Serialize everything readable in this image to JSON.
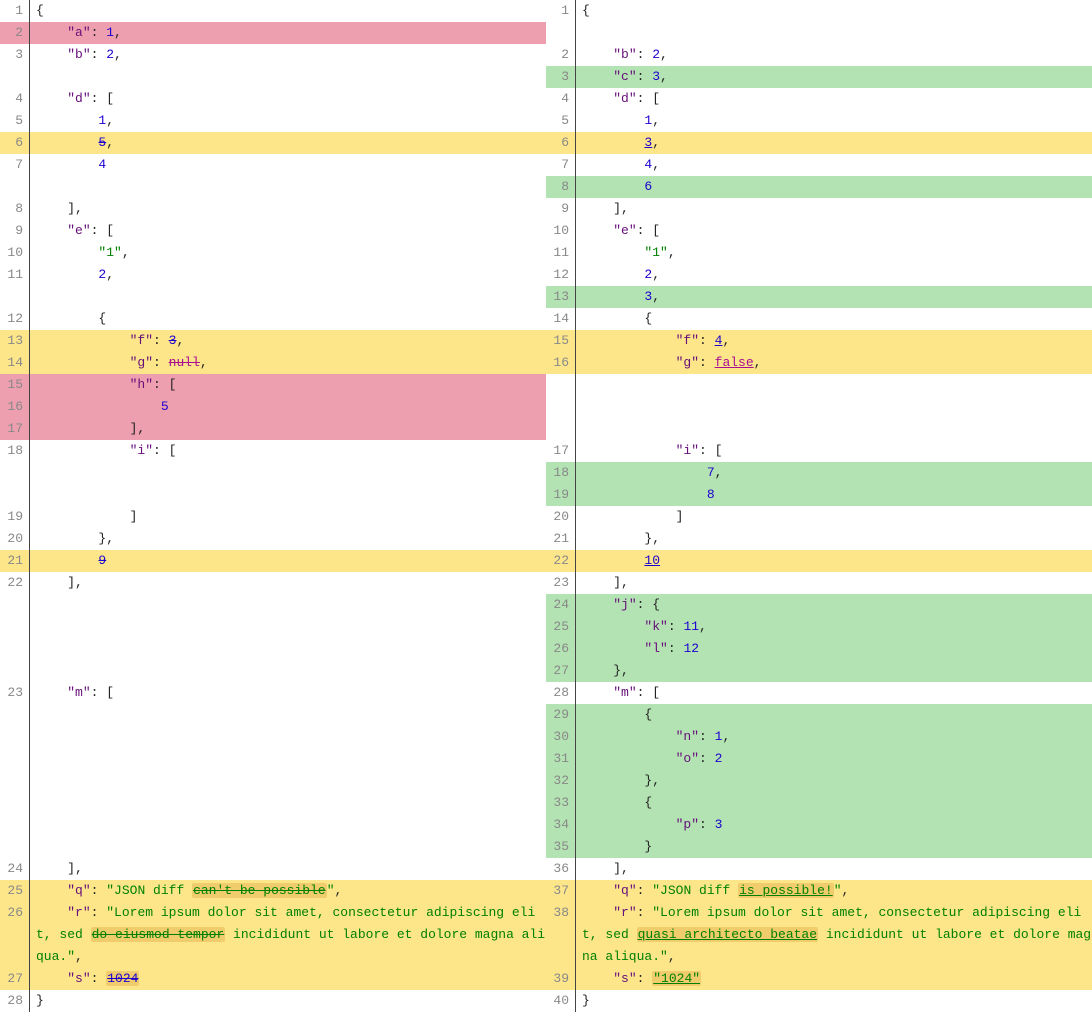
{
  "left": [
    {
      "n": 1,
      "cls": "",
      "tokens": [
        {
          "t": "{",
          "c": "p"
        }
      ]
    },
    {
      "n": 2,
      "cls": "remove",
      "tokens": [
        {
          "t": "    ",
          "c": "p"
        },
        {
          "t": "\"a\"",
          "c": "k"
        },
        {
          "t": ": ",
          "c": "p"
        },
        {
          "t": "1",
          "c": "n"
        },
        {
          "t": ",",
          "c": "p"
        }
      ]
    },
    {
      "n": 3,
      "cls": "",
      "tokens": [
        {
          "t": "    ",
          "c": "p"
        },
        {
          "t": "\"b\"",
          "c": "k"
        },
        {
          "t": ": ",
          "c": "p"
        },
        {
          "t": "2",
          "c": "n"
        },
        {
          "t": ",",
          "c": "p"
        }
      ]
    },
    {
      "n": "",
      "cls": "blank",
      "tokens": []
    },
    {
      "n": 4,
      "cls": "",
      "tokens": [
        {
          "t": "    ",
          "c": "p"
        },
        {
          "t": "\"d\"",
          "c": "k"
        },
        {
          "t": ": [",
          "c": "p"
        }
      ]
    },
    {
      "n": 5,
      "cls": "",
      "tokens": [
        {
          "t": "        ",
          "c": "p"
        },
        {
          "t": "1",
          "c": "n"
        },
        {
          "t": ",",
          "c": "p"
        }
      ]
    },
    {
      "n": 6,
      "cls": "modify",
      "tokens": [
        {
          "t": "        ",
          "c": "p"
        },
        {
          "t": "5",
          "c": "n",
          "d": "strike"
        },
        {
          "t": ",",
          "c": "p"
        }
      ]
    },
    {
      "n": 7,
      "cls": "",
      "tokens": [
        {
          "t": "        ",
          "c": "p"
        },
        {
          "t": "4",
          "c": "n"
        }
      ]
    },
    {
      "n": "",
      "cls": "blank",
      "tokens": []
    },
    {
      "n": 8,
      "cls": "",
      "tokens": [
        {
          "t": "    ],",
          "c": "p"
        }
      ]
    },
    {
      "n": 9,
      "cls": "",
      "tokens": [
        {
          "t": "    ",
          "c": "p"
        },
        {
          "t": "\"e\"",
          "c": "k"
        },
        {
          "t": ": [",
          "c": "p"
        }
      ]
    },
    {
      "n": 10,
      "cls": "",
      "tokens": [
        {
          "t": "        ",
          "c": "p"
        },
        {
          "t": "\"1\"",
          "c": "s"
        },
        {
          "t": ",",
          "c": "p"
        }
      ]
    },
    {
      "n": 11,
      "cls": "",
      "tokens": [
        {
          "t": "        ",
          "c": "p"
        },
        {
          "t": "2",
          "c": "n"
        },
        {
          "t": ",",
          "c": "p"
        }
      ]
    },
    {
      "n": "",
      "cls": "blank",
      "tokens": []
    },
    {
      "n": 12,
      "cls": "",
      "tokens": [
        {
          "t": "        {",
          "c": "p"
        }
      ]
    },
    {
      "n": 13,
      "cls": "modify",
      "tokens": [
        {
          "t": "            ",
          "c": "p"
        },
        {
          "t": "\"f\"",
          "c": "k"
        },
        {
          "t": ": ",
          "c": "p"
        },
        {
          "t": "3",
          "c": "n",
          "d": "strike"
        },
        {
          "t": ",",
          "c": "p"
        }
      ]
    },
    {
      "n": 14,
      "cls": "modify",
      "tokens": [
        {
          "t": "            ",
          "c": "p"
        },
        {
          "t": "\"g\"",
          "c": "k"
        },
        {
          "t": ": ",
          "c": "p"
        },
        {
          "t": "null",
          "c": "b",
          "d": "strike"
        },
        {
          "t": ",",
          "c": "p"
        }
      ]
    },
    {
      "n": 15,
      "cls": "remove",
      "tokens": [
        {
          "t": "            ",
          "c": "p"
        },
        {
          "t": "\"h\"",
          "c": "k"
        },
        {
          "t": ": [",
          "c": "p"
        }
      ]
    },
    {
      "n": 16,
      "cls": "remove",
      "tokens": [
        {
          "t": "                ",
          "c": "p"
        },
        {
          "t": "5",
          "c": "n"
        }
      ]
    },
    {
      "n": 17,
      "cls": "remove",
      "tokens": [
        {
          "t": "            ],",
          "c": "p"
        }
      ]
    },
    {
      "n": 18,
      "cls": "",
      "tokens": [
        {
          "t": "            ",
          "c": "p"
        },
        {
          "t": "\"i\"",
          "c": "k"
        },
        {
          "t": ": [",
          "c": "p"
        }
      ]
    },
    {
      "n": "",
      "cls": "blank",
      "tokens": []
    },
    {
      "n": "",
      "cls": "blank",
      "tokens": []
    },
    {
      "n": 19,
      "cls": "",
      "tokens": [
        {
          "t": "            ]",
          "c": "p"
        }
      ]
    },
    {
      "n": 20,
      "cls": "",
      "tokens": [
        {
          "t": "        },",
          "c": "p"
        }
      ]
    },
    {
      "n": 21,
      "cls": "modify",
      "tokens": [
        {
          "t": "        ",
          "c": "p"
        },
        {
          "t": "9",
          "c": "n",
          "d": "strike"
        }
      ]
    },
    {
      "n": 22,
      "cls": "",
      "tokens": [
        {
          "t": "    ],",
          "c": "p"
        }
      ]
    },
    {
      "n": "",
      "cls": "blank",
      "tokens": []
    },
    {
      "n": "",
      "cls": "blank",
      "tokens": []
    },
    {
      "n": "",
      "cls": "blank",
      "tokens": []
    },
    {
      "n": "",
      "cls": "blank",
      "tokens": []
    },
    {
      "n": 23,
      "cls": "",
      "tokens": [
        {
          "t": "    ",
          "c": "p"
        },
        {
          "t": "\"m\"",
          "c": "k"
        },
        {
          "t": ": [",
          "c": "p"
        }
      ]
    },
    {
      "n": "",
      "cls": "blank",
      "tokens": []
    },
    {
      "n": "",
      "cls": "blank",
      "tokens": []
    },
    {
      "n": "",
      "cls": "blank",
      "tokens": []
    },
    {
      "n": "",
      "cls": "blank",
      "tokens": []
    },
    {
      "n": "",
      "cls": "blank",
      "tokens": []
    },
    {
      "n": "",
      "cls": "blank",
      "tokens": []
    },
    {
      "n": "",
      "cls": "blank",
      "tokens": []
    },
    {
      "n": 24,
      "cls": "",
      "tokens": [
        {
          "t": "    ],",
          "c": "p"
        }
      ]
    },
    {
      "n": 25,
      "cls": "modify",
      "tokens": [
        {
          "t": "    ",
          "c": "p"
        },
        {
          "t": "\"q\"",
          "c": "k"
        },
        {
          "t": ": ",
          "c": "p"
        },
        {
          "t": "\"JSON diff ",
          "c": "s"
        },
        {
          "t": "can't be possible",
          "c": "s",
          "d": "strike",
          "hl": 1
        },
        {
          "t": "\"",
          "c": "s"
        },
        {
          "t": ",",
          "c": "p"
        }
      ]
    },
    {
      "n": 26,
      "cls": "modify",
      "tokens": [
        {
          "t": "    ",
          "c": "p"
        },
        {
          "t": "\"r\"",
          "c": "k"
        },
        {
          "t": ": ",
          "c": "p"
        },
        {
          "t": "\"Lorem ipsum dolor sit amet, consectetur adipiscing elit, sed ",
          "c": "s"
        },
        {
          "t": "do eiusmod tempor",
          "c": "s",
          "d": "strike",
          "hl": 1
        },
        {
          "t": " incididunt ut labore et dolore magna aliqua.\"",
          "c": "s"
        },
        {
          "t": ",",
          "c": "p"
        }
      ]
    },
    {
      "n": 27,
      "cls": "modify",
      "tokens": [
        {
          "t": "    ",
          "c": "p"
        },
        {
          "t": "\"s\"",
          "c": "k"
        },
        {
          "t": ": ",
          "c": "p"
        },
        {
          "t": "1024",
          "c": "n",
          "d": "strike",
          "hl": 1
        }
      ]
    },
    {
      "n": 28,
      "cls": "",
      "tokens": [
        {
          "t": "}",
          "c": "p"
        }
      ]
    }
  ],
  "right": [
    {
      "n": 1,
      "cls": "",
      "tokens": [
        {
          "t": "{",
          "c": "p"
        }
      ]
    },
    {
      "n": "",
      "cls": "blank",
      "tokens": []
    },
    {
      "n": 2,
      "cls": "",
      "tokens": [
        {
          "t": "    ",
          "c": "p"
        },
        {
          "t": "\"b\"",
          "c": "k"
        },
        {
          "t": ": ",
          "c": "p"
        },
        {
          "t": "2",
          "c": "n"
        },
        {
          "t": ",",
          "c": "p"
        }
      ]
    },
    {
      "n": 3,
      "cls": "add",
      "tokens": [
        {
          "t": "    ",
          "c": "p"
        },
        {
          "t": "\"c\"",
          "c": "k"
        },
        {
          "t": ": ",
          "c": "p"
        },
        {
          "t": "3",
          "c": "n"
        },
        {
          "t": ",",
          "c": "p"
        }
      ]
    },
    {
      "n": 4,
      "cls": "",
      "tokens": [
        {
          "t": "    ",
          "c": "p"
        },
        {
          "t": "\"d\"",
          "c": "k"
        },
        {
          "t": ": [",
          "c": "p"
        }
      ]
    },
    {
      "n": 5,
      "cls": "",
      "tokens": [
        {
          "t": "        ",
          "c": "p"
        },
        {
          "t": "1",
          "c": "n"
        },
        {
          "t": ",",
          "c": "p"
        }
      ]
    },
    {
      "n": 6,
      "cls": "modify",
      "tokens": [
        {
          "t": "        ",
          "c": "p"
        },
        {
          "t": "3",
          "c": "n",
          "d": "under"
        },
        {
          "t": ",",
          "c": "p"
        }
      ]
    },
    {
      "n": 7,
      "cls": "",
      "tokens": [
        {
          "t": "        ",
          "c": "p"
        },
        {
          "t": "4",
          "c": "n"
        },
        {
          "t": ",",
          "c": "p"
        }
      ]
    },
    {
      "n": 8,
      "cls": "add",
      "tokens": [
        {
          "t": "        ",
          "c": "p"
        },
        {
          "t": "6",
          "c": "n"
        }
      ]
    },
    {
      "n": 9,
      "cls": "",
      "tokens": [
        {
          "t": "    ],",
          "c": "p"
        }
      ]
    },
    {
      "n": 10,
      "cls": "",
      "tokens": [
        {
          "t": "    ",
          "c": "p"
        },
        {
          "t": "\"e\"",
          "c": "k"
        },
        {
          "t": ": [",
          "c": "p"
        }
      ]
    },
    {
      "n": 11,
      "cls": "",
      "tokens": [
        {
          "t": "        ",
          "c": "p"
        },
        {
          "t": "\"1\"",
          "c": "s"
        },
        {
          "t": ",",
          "c": "p"
        }
      ]
    },
    {
      "n": 12,
      "cls": "",
      "tokens": [
        {
          "t": "        ",
          "c": "p"
        },
        {
          "t": "2",
          "c": "n"
        },
        {
          "t": ",",
          "c": "p"
        }
      ]
    },
    {
      "n": 13,
      "cls": "add",
      "tokens": [
        {
          "t": "        ",
          "c": "p"
        },
        {
          "t": "3",
          "c": "n"
        },
        {
          "t": ",",
          "c": "p"
        }
      ]
    },
    {
      "n": 14,
      "cls": "",
      "tokens": [
        {
          "t": "        {",
          "c": "p"
        }
      ]
    },
    {
      "n": 15,
      "cls": "modify",
      "tokens": [
        {
          "t": "            ",
          "c": "p"
        },
        {
          "t": "\"f\"",
          "c": "k"
        },
        {
          "t": ": ",
          "c": "p"
        },
        {
          "t": "4",
          "c": "n",
          "d": "under"
        },
        {
          "t": ",",
          "c": "p"
        }
      ]
    },
    {
      "n": 16,
      "cls": "modify",
      "tokens": [
        {
          "t": "            ",
          "c": "p"
        },
        {
          "t": "\"g\"",
          "c": "k"
        },
        {
          "t": ": ",
          "c": "p"
        },
        {
          "t": "false",
          "c": "b",
          "d": "under"
        },
        {
          "t": ",",
          "c": "p"
        }
      ]
    },
    {
      "n": "",
      "cls": "blank",
      "tokens": []
    },
    {
      "n": "",
      "cls": "blank",
      "tokens": []
    },
    {
      "n": "",
      "cls": "blank",
      "tokens": []
    },
    {
      "n": 17,
      "cls": "",
      "tokens": [
        {
          "t": "            ",
          "c": "p"
        },
        {
          "t": "\"i\"",
          "c": "k"
        },
        {
          "t": ": [",
          "c": "p"
        }
      ]
    },
    {
      "n": 18,
      "cls": "add",
      "tokens": [
        {
          "t": "                ",
          "c": "p"
        },
        {
          "t": "7",
          "c": "n"
        },
        {
          "t": ",",
          "c": "p"
        }
      ]
    },
    {
      "n": 19,
      "cls": "add",
      "tokens": [
        {
          "t": "                ",
          "c": "p"
        },
        {
          "t": "8",
          "c": "n"
        }
      ]
    },
    {
      "n": 20,
      "cls": "",
      "tokens": [
        {
          "t": "            ]",
          "c": "p"
        }
      ]
    },
    {
      "n": 21,
      "cls": "",
      "tokens": [
        {
          "t": "        },",
          "c": "p"
        }
      ]
    },
    {
      "n": 22,
      "cls": "modify",
      "tokens": [
        {
          "t": "        ",
          "c": "p"
        },
        {
          "t": "10",
          "c": "n",
          "d": "under"
        }
      ]
    },
    {
      "n": 23,
      "cls": "",
      "tokens": [
        {
          "t": "    ],",
          "c": "p"
        }
      ]
    },
    {
      "n": 24,
      "cls": "add",
      "tokens": [
        {
          "t": "    ",
          "c": "p"
        },
        {
          "t": "\"j\"",
          "c": "k"
        },
        {
          "t": ": {",
          "c": "p"
        }
      ]
    },
    {
      "n": 25,
      "cls": "add",
      "tokens": [
        {
          "t": "        ",
          "c": "p"
        },
        {
          "t": "\"k\"",
          "c": "k"
        },
        {
          "t": ": ",
          "c": "p"
        },
        {
          "t": "11",
          "c": "n"
        },
        {
          "t": ",",
          "c": "p"
        }
      ]
    },
    {
      "n": 26,
      "cls": "add",
      "tokens": [
        {
          "t": "        ",
          "c": "p"
        },
        {
          "t": "\"l\"",
          "c": "k"
        },
        {
          "t": ": ",
          "c": "p"
        },
        {
          "t": "12",
          "c": "n"
        }
      ]
    },
    {
      "n": 27,
      "cls": "add",
      "tokens": [
        {
          "t": "    },",
          "c": "p"
        }
      ]
    },
    {
      "n": 28,
      "cls": "",
      "tokens": [
        {
          "t": "    ",
          "c": "p"
        },
        {
          "t": "\"m\"",
          "c": "k"
        },
        {
          "t": ": [",
          "c": "p"
        }
      ]
    },
    {
      "n": 29,
      "cls": "add",
      "tokens": [
        {
          "t": "        {",
          "c": "p"
        }
      ]
    },
    {
      "n": 30,
      "cls": "add",
      "tokens": [
        {
          "t": "            ",
          "c": "p"
        },
        {
          "t": "\"n\"",
          "c": "k"
        },
        {
          "t": ": ",
          "c": "p"
        },
        {
          "t": "1",
          "c": "n"
        },
        {
          "t": ",",
          "c": "p"
        }
      ]
    },
    {
      "n": 31,
      "cls": "add",
      "tokens": [
        {
          "t": "            ",
          "c": "p"
        },
        {
          "t": "\"o\"",
          "c": "k"
        },
        {
          "t": ": ",
          "c": "p"
        },
        {
          "t": "2",
          "c": "n"
        }
      ]
    },
    {
      "n": 32,
      "cls": "add",
      "tokens": [
        {
          "t": "        },",
          "c": "p"
        }
      ]
    },
    {
      "n": 33,
      "cls": "add",
      "tokens": [
        {
          "t": "        {",
          "c": "p"
        }
      ]
    },
    {
      "n": 34,
      "cls": "add",
      "tokens": [
        {
          "t": "            ",
          "c": "p"
        },
        {
          "t": "\"p\"",
          "c": "k"
        },
        {
          "t": ": ",
          "c": "p"
        },
        {
          "t": "3",
          "c": "n"
        }
      ]
    },
    {
      "n": 35,
      "cls": "add",
      "tokens": [
        {
          "t": "        }",
          "c": "p"
        }
      ]
    },
    {
      "n": 36,
      "cls": "",
      "tokens": [
        {
          "t": "    ],",
          "c": "p"
        }
      ]
    },
    {
      "n": 37,
      "cls": "modify",
      "tokens": [
        {
          "t": "    ",
          "c": "p"
        },
        {
          "t": "\"q\"",
          "c": "k"
        },
        {
          "t": ": ",
          "c": "p"
        },
        {
          "t": "\"JSON diff ",
          "c": "s"
        },
        {
          "t": "is possible!",
          "c": "s",
          "d": "under",
          "hl": 1
        },
        {
          "t": "\"",
          "c": "s"
        },
        {
          "t": ",",
          "c": "p"
        }
      ]
    },
    {
      "n": 38,
      "cls": "modify",
      "tokens": [
        {
          "t": "    ",
          "c": "p"
        },
        {
          "t": "\"r\"",
          "c": "k"
        },
        {
          "t": ": ",
          "c": "p"
        },
        {
          "t": "\"Lorem ipsum dolor sit amet, consectetur adipiscing elit, sed ",
          "c": "s"
        },
        {
          "t": "quasi architecto beatae",
          "c": "s",
          "d": "under",
          "hl": 1
        },
        {
          "t": " incididunt ut labore et dolore magna aliqua.\"",
          "c": "s"
        },
        {
          "t": ",",
          "c": "p"
        }
      ]
    },
    {
      "n": 39,
      "cls": "modify",
      "tokens": [
        {
          "t": "    ",
          "c": "p"
        },
        {
          "t": "\"s\"",
          "c": "k"
        },
        {
          "t": ": ",
          "c": "p"
        },
        {
          "t": "\"1024\"",
          "c": "s",
          "d": "under",
          "hl": 1
        }
      ]
    },
    {
      "n": 40,
      "cls": "",
      "tokens": [
        {
          "t": "}",
          "c": "p"
        }
      ]
    }
  ]
}
